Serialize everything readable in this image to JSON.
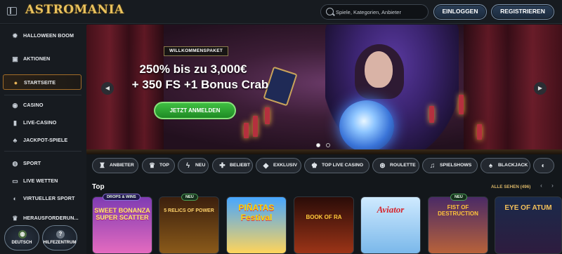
{
  "app": {
    "logo": "ASTROMANIA"
  },
  "header": {
    "search_placeholder": "Spiele, Kategorien, Anbieter",
    "login_label": "EINLOGGEN",
    "register_label": "REGISTRIEREN"
  },
  "sidebar": {
    "items": [
      {
        "label": "HALLOWEEN BOOM",
        "icon": "pumpkin-icon"
      },
      {
        "label": "AKTIONEN",
        "icon": "gift-icon"
      },
      {
        "label": "STARTSEITE",
        "icon": "home-icon",
        "active": true
      },
      {
        "label": "CASINO",
        "icon": "chip-icon"
      },
      {
        "label": "LIVE-CASINO",
        "icon": "card-icon"
      },
      {
        "label": "JACKPOT-SPIELE",
        "icon": "clover-icon"
      },
      {
        "label": "SPORT",
        "icon": "ball-icon"
      },
      {
        "label": "LIVE WETTEN",
        "icon": "live-icon"
      },
      {
        "label": "VIRTUELLER SPORT",
        "icon": "controller-icon"
      },
      {
        "label": "HERAUSFORDERUN...",
        "icon": "trophy-icon"
      }
    ],
    "language_label": "DEUTSCH",
    "help_label": "HILFEZENTRUM"
  },
  "hero": {
    "badge": "WILLKOMMENSPAKET",
    "line1": "250% bis zu 3,000€",
    "line2": "+ 350 FS +1 Bonus Crab",
    "cta": "JETZT ANMELDEN",
    "slides": 2,
    "active_slide": 1
  },
  "filters": [
    {
      "label": "ANBIETER",
      "icon": "provider-icon"
    },
    {
      "label": "TOP",
      "icon": "trophy-icon"
    },
    {
      "label": "NEU",
      "icon": "lightning-icon"
    },
    {
      "label": "BELIEBT",
      "icon": "thumb-icon"
    },
    {
      "label": "EXKLUSIV",
      "icon": "diamond-icon"
    },
    {
      "label": "TOP LIVE CASINO",
      "icon": "crown-icon"
    },
    {
      "label": "ROULETTE",
      "icon": "roulette-icon"
    },
    {
      "label": "SPIELSHOWS",
      "icon": "mic-icon"
    },
    {
      "label": "BLACKJACK",
      "icon": "cards-icon"
    }
  ],
  "section": {
    "title": "Top",
    "see_all": "ALLE SEHEN (496)"
  },
  "games": [
    {
      "title": "SWEET BONANZA SUPER SCATTER",
      "tag": "DROPS & WINS"
    },
    {
      "title": "5 RELICS OF POWER",
      "tag": "NEU"
    },
    {
      "title": "PIÑATAS Festival",
      "tag": ""
    },
    {
      "title": "BOOK OF RA",
      "tag": ""
    },
    {
      "title": "Aviator",
      "tag": ""
    },
    {
      "title": "FIST OF DESTRUCTION",
      "tag": "NEU"
    },
    {
      "title": "EYE OF ATUM",
      "tag": ""
    }
  ]
}
